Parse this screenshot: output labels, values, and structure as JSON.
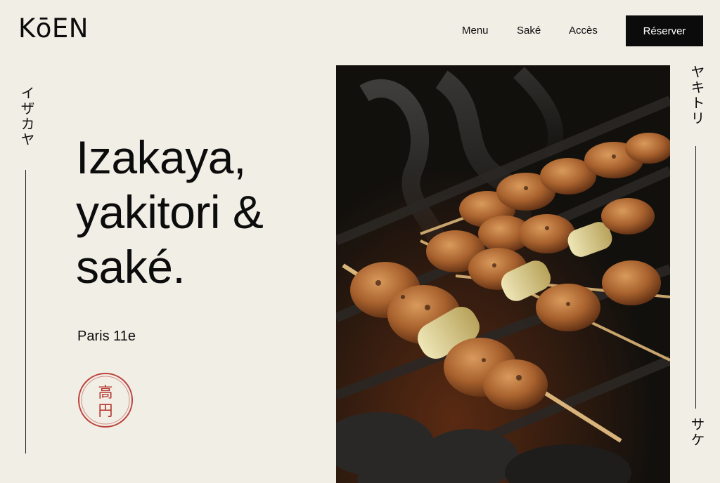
{
  "brand": {
    "logo": "KōEN"
  },
  "nav": {
    "items": [
      {
        "label": "Menu"
      },
      {
        "label": "Saké"
      },
      {
        "label": "Accès"
      }
    ],
    "cta_label": "Réserver"
  },
  "side": {
    "left_vertical": "イザカヤ",
    "right_top_vertical": "ヤキトリ",
    "right_bottom_vertical": "サケ"
  },
  "hero": {
    "title_lines": [
      "Izakaya,",
      "yakitori &",
      "saké."
    ],
    "location": "Paris 11e",
    "stamp_text": "高円"
  },
  "colors": {
    "background": "#f1eee6",
    "ink": "#0c0c0c",
    "button": "#0b0b0b",
    "stamp_red": "#b5302a"
  }
}
